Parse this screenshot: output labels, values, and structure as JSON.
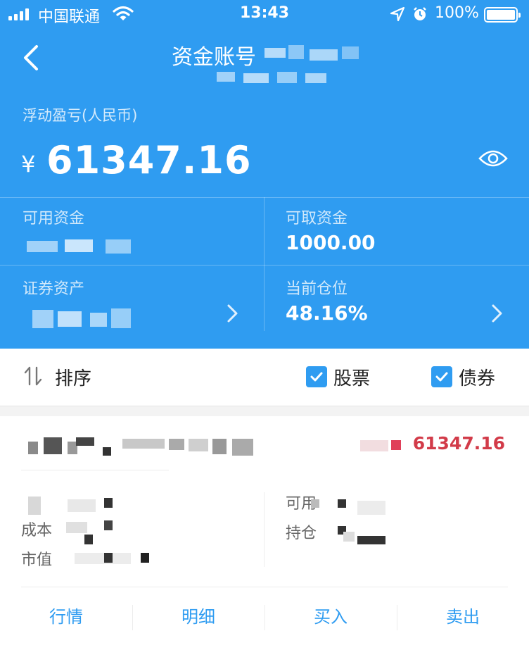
{
  "status_bar": {
    "carrier": "中国联通",
    "time": "13:43",
    "battery": "100%"
  },
  "header": {
    "title": "资金账号",
    "back_icon": "chevron-left-icon"
  },
  "summary": {
    "floating_pnl_label": "浮动盈亏(人民币)",
    "currency_symbol": "¥",
    "floating_pnl_value": "61347.16",
    "visibility_icon": "eye-icon"
  },
  "balances": {
    "available_funds_label": "可用资金",
    "withdrawable_funds_label": "可取资金",
    "withdrawable_funds_value": "1000.00",
    "securities_assets_label": "证券资产",
    "position_label": "当前仓位",
    "position_value": "48.16%"
  },
  "filter_bar": {
    "sort_label": "排序",
    "stock_label": "股票",
    "stock_checked": true,
    "bond_label": "债券",
    "bond_checked": true
  },
  "holding": {
    "pnl_value": "61347.16",
    "cost_label": "成本",
    "market_value_label": "市值",
    "available_label": "可用",
    "position_label": "持仓",
    "actions": {
      "quote": "行情",
      "detail": "明细",
      "buy": "买入",
      "sell": "卖出"
    }
  },
  "colors": {
    "brand_blue": "#2f9cf1",
    "loss_red": "#d23b49"
  }
}
